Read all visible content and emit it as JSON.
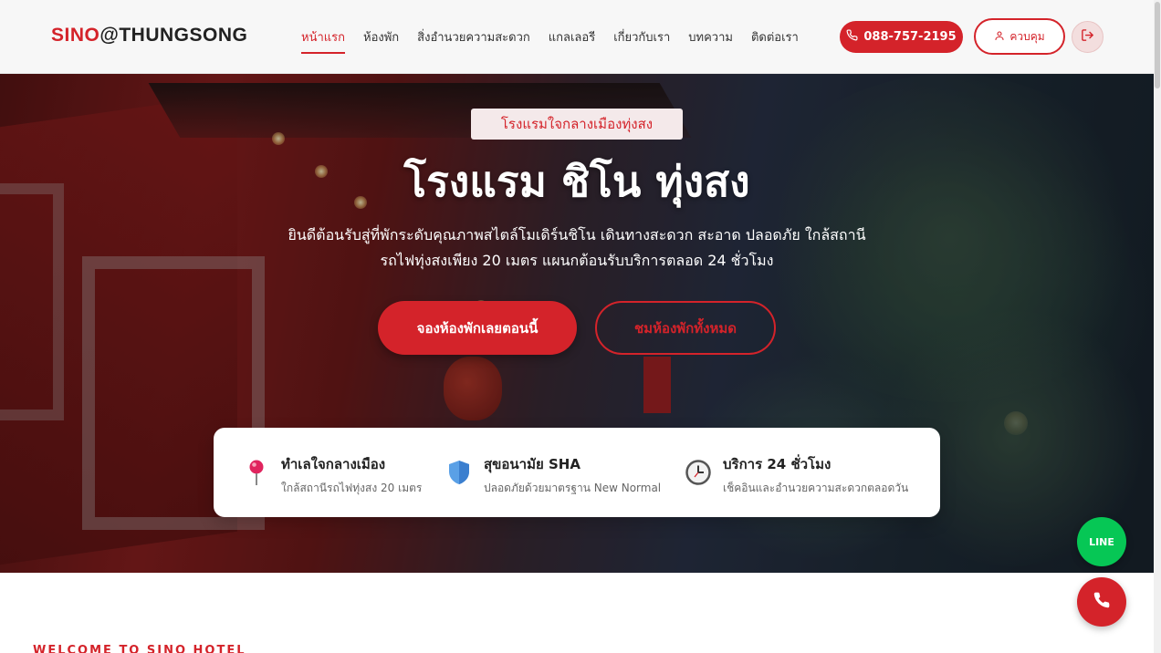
{
  "header": {
    "logo_part1": "SINO",
    "logo_at": "@",
    "logo_part2": "THUNGSONG",
    "nav": [
      {
        "label": "หน้าแรก"
      },
      {
        "label": "ห้องพัก"
      },
      {
        "label": "สิ่งอำนวยความสะดวก"
      },
      {
        "label": "แกลเลอรี"
      },
      {
        "label": "เกี่ยวกับเรา"
      },
      {
        "label": "บทความ"
      },
      {
        "label": "ติดต่อเรา"
      }
    ],
    "phone_label": "088-757-2195",
    "login_label": "ควบคุม"
  },
  "hero": {
    "tag": "โรงแรมใจกลางเมืองทุ่งสง",
    "title": "โรงแรม ชิโน ทุ่งสง",
    "desc_line1": "ยินดีต้อนรับสู่ที่พักระดับคุณภาพสไตล์โมเดิร์นชิโน เดินทางสะดวก สะอาด ปลอดภัย ใกล้สถานี",
    "desc_line2": "รถไฟทุ่งสงเพียง 20 เมตร แผนกต้อนรับบริการตลอด 24 ชั่วโมง",
    "book_label": "จองห้องพักเลยตอนนี้",
    "rooms_label": "ชมห้องพักทั้งหมด"
  },
  "features": [
    {
      "title": "ทำเลใจกลางเมือง",
      "subtitle": "ใกล้สถานีรถไฟทุ่งสง 20 เมตร",
      "icon": "pin-icon"
    },
    {
      "title": "สุขอนามัย SHA",
      "subtitle": "ปลอดภัยด้วยมาตรฐาน New Normal",
      "icon": "shield-icon"
    },
    {
      "title": "บริการ 24 ชั่วโมง",
      "subtitle": "เช็คอินและอำนวยความสะดวกตลอดวัน",
      "icon": "clock-icon"
    }
  ],
  "welcome": "WELCOME TO SINO HOTEL",
  "fab": {
    "line_label": "LINE"
  },
  "colors": {
    "accent": "#d4232a",
    "line_green": "#06c755"
  }
}
